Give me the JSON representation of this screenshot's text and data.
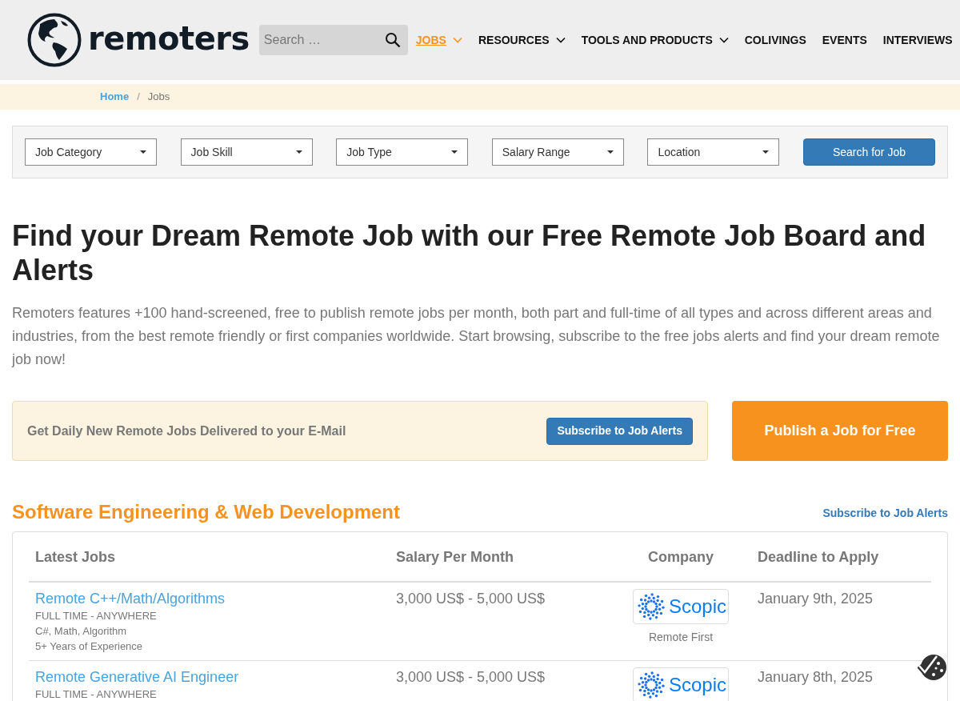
{
  "header": {
    "logo_text": "remoters",
    "search": {
      "placeholder": "Search …"
    },
    "nav": [
      {
        "label": "JOBS",
        "selected": true,
        "has_menu": true
      },
      {
        "label": "RESOURCES",
        "selected": false,
        "has_menu": true
      },
      {
        "label": "TOOLS AND PRODUCTS",
        "selected": false,
        "has_menu": true
      },
      {
        "label": "COLIVINGS",
        "selected": false,
        "has_menu": false
      },
      {
        "label": "EVENTS",
        "selected": false,
        "has_menu": false
      },
      {
        "label": "INTERVIEWS",
        "selected": false,
        "has_menu": false
      }
    ]
  },
  "breadcrumb": [
    {
      "label": "Home",
      "kind": "link"
    },
    {
      "label": "Jobs",
      "kind": "current",
      "separator": "/"
    }
  ],
  "filters": {
    "selects": [
      "Job Category",
      "Job Skill",
      "Job Type",
      "Salary Range",
      "Location"
    ],
    "button": "Search for Job"
  },
  "hero": {
    "title": "Find your Dream Remote Job with our Free Remote Job Board and Alerts",
    "text": "Remoters features +100 hand-screened, free to publish remote jobs per month, both part and full-time of all types and across different areas and industries, from the best remote friendly or first companies worldwide. Start browsing, subscribe to the free jobs alerts and find your dream remote job now!"
  },
  "alerts": {
    "text": "Get Daily New Remote Jobs Delivered to your E-Mail",
    "button": "Subscribe to Job Alerts"
  },
  "publish_button": "Publish a Job for Free",
  "section": {
    "title": "Software Engineering & Web Development",
    "link": "Subscribe to Job Alerts",
    "table": {
      "columns": [
        "Latest Jobs",
        "Salary Per Month",
        "Company",
        "Deadline to Apply"
      ],
      "rows": [
        {
          "title": "Remote C++/Math/Algorithms",
          "details": [
            "FULL TIME - ANYWHERE",
            "C#, Math, Algorithm",
            "5+ Years of Experience"
          ],
          "salary": "3,000 US$ - 5,000 US$",
          "company": "Scopic",
          "company_note": "Remote First",
          "deadline": "January 9th, 2025"
        },
        {
          "title": "Remote Generative AI Engineer",
          "details": [
            "FULL TIME - ANYWHERE"
          ],
          "salary": "3,000 US$ - 5,000 US$",
          "company": "Scopic",
          "deadline": "January 8th, 2025"
        }
      ]
    }
  }
}
